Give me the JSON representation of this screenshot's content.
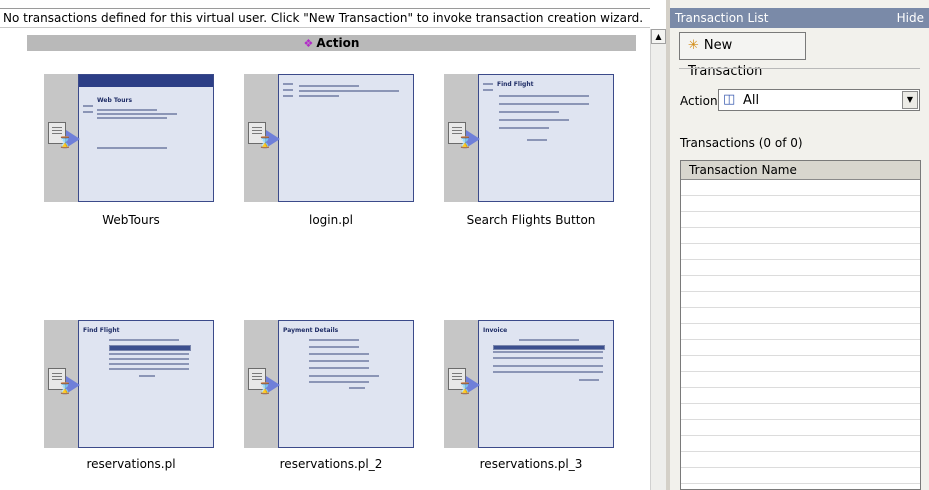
{
  "message_bar": {
    "text": "No transactions defined for this virtual user. Click \"New Transaction\" to invoke transaction creation wizard."
  },
  "action_header": {
    "icon": "action-icon",
    "label": "Action"
  },
  "steps": [
    {
      "label": "WebTours"
    },
    {
      "label": "login.pl"
    },
    {
      "label": "Search Flights Button"
    },
    {
      "label": "reservations.pl"
    },
    {
      "label": "reservations.pl_2"
    },
    {
      "label": "reservations.pl_3"
    }
  ],
  "right_panel": {
    "title": "Transaction List",
    "hide_label": "Hide",
    "new_transaction_label": "New Transaction",
    "action_label": "Action:",
    "action_selected": "All",
    "transactions_count": "Transactions (0 of 0)",
    "grid_header": "Transaction Name"
  },
  "colors": {
    "title_bar": "#7a8aa8",
    "action_header_bg": "#b9b9b9",
    "thumbnail_bg": "#dfe4f1"
  }
}
